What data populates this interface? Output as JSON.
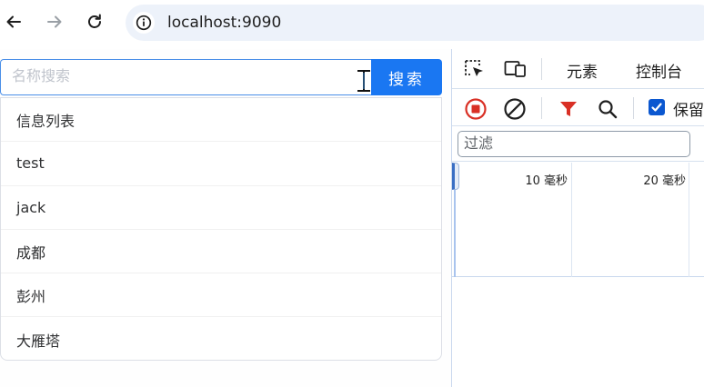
{
  "browser": {
    "url": "localhost:9090"
  },
  "page": {
    "search": {
      "placeholder": "名称搜索",
      "value": "",
      "button_label": "搜索"
    },
    "results": [
      {
        "label": "信息列表"
      },
      {
        "label": "test"
      },
      {
        "label": "jack"
      },
      {
        "label": "成都"
      },
      {
        "label": "彭州"
      },
      {
        "label": "大雁塔"
      }
    ]
  },
  "devtools": {
    "tabs": [
      {
        "label": "元素"
      },
      {
        "label": "控制台"
      }
    ],
    "preserve_log_label": "保留",
    "preserve_log_checked": true,
    "filter_placeholder": "过滤",
    "timeline_labels": [
      "10 毫秒",
      "20 毫秒"
    ]
  },
  "colors": {
    "accent": "#1a77f2",
    "record_red": "#d93025",
    "filter_red": "#d93025",
    "checkbox_blue": "#0b57d0"
  }
}
